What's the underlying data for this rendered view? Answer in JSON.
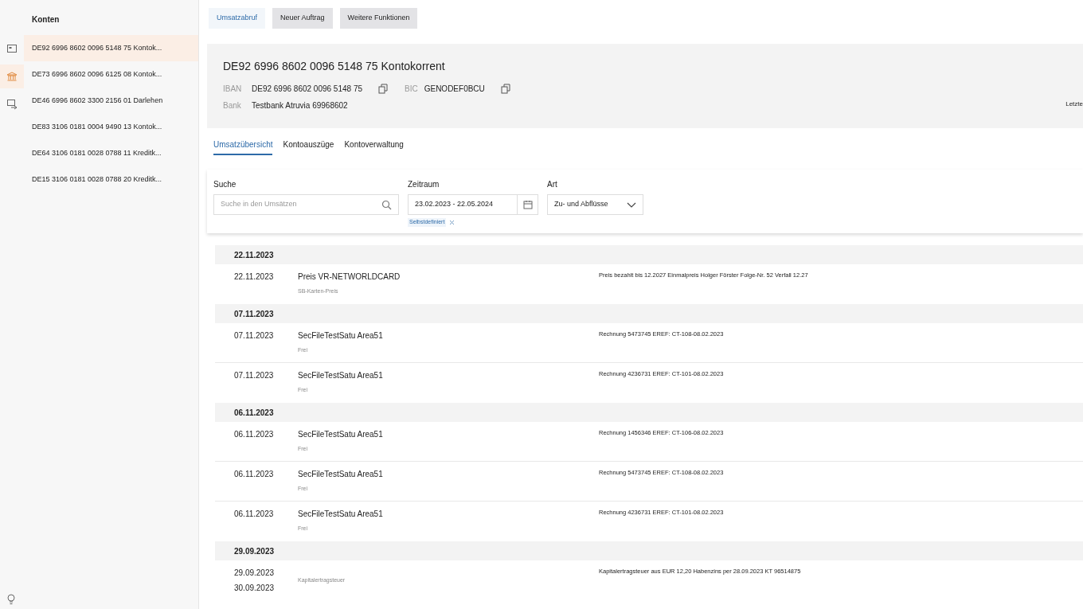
{
  "nav_rail": [
    {
      "kind": "card",
      "selected": false
    },
    {
      "kind": "bank",
      "selected": true
    },
    {
      "kind": "transfer",
      "selected": false
    }
  ],
  "sidebar": {
    "title": "Konten",
    "items": [
      {
        "label": "DE92 6996 8602 0096 5148 75 Kontok...",
        "selected": true
      },
      {
        "label": "DE73 6996 8602 0096 6125 08 Kontok...",
        "selected": false
      },
      {
        "label": "DE46 6996 8602 3300 2156 01 Darlehen",
        "selected": false
      },
      {
        "label": "DE83 3106 0181 0004 9490 13 Kontok...",
        "selected": false
      },
      {
        "label": "DE64 3106 0181 0028 0788 11 Kreditk...",
        "selected": false
      },
      {
        "label": "DE15 3106 0181 0028 0788 20 Kreditk...",
        "selected": false
      }
    ]
  },
  "toolbar": [
    {
      "label": "Umsatzabruf",
      "selected": true
    },
    {
      "label": "Neuer Auftrag",
      "selected": false
    },
    {
      "label": "Weitere Funktionen",
      "selected": false
    }
  ],
  "account": {
    "title": "DE92 6996 8602 0096 5148 75 Kontokorrent",
    "iban_label": "IBAN",
    "iban": "DE92 6996 8602 0096 5148 75",
    "bic_label": "BIC",
    "bic": "GENODEF0BCU",
    "bank_label": "Bank",
    "bank": "Testbank Atruvia 69968602",
    "side_label": "Letzte"
  },
  "tabs": [
    {
      "label": "Umsatzübersicht",
      "selected": true
    },
    {
      "label": "Kontoauszüge",
      "selected": false
    },
    {
      "label": "Kontoverwaltung",
      "selected": false
    }
  ],
  "filters": {
    "search_label": "Suche",
    "search_placeholder": "Suche in den Umsätzen",
    "period_label": "Zeitraum",
    "period": "23.02.2023 - 22.05.2024",
    "period_chip": "Selbstdefiniert",
    "type_label": "Art",
    "type": "Zu- und Abflüsse"
  },
  "groups": [
    {
      "date": "22.11.2023",
      "items": [
        {
          "date": "22.11.2023",
          "title": "Preis VR-NETWORLDCARD",
          "subtitle": "SB-Karten-Preis",
          "description": "Preis bezahlt bis 12.2027 Einmalpreis Holger Förster Folge-Nr. 52 Verfall 12.27"
        }
      ]
    },
    {
      "date": "07.11.2023",
      "items": [
        {
          "date": "07.11.2023",
          "title": "SecFileTestSatu Area51",
          "subtitle": "Frei",
          "description": "Rechnung 5473745 EREF: CT-108-08.02.2023"
        },
        {
          "date": "07.11.2023",
          "title": "SecFileTestSatu Area51",
          "subtitle": "Frei",
          "description": "Rechnung 4236731 EREF: CT-101-08.02.2023"
        }
      ]
    },
    {
      "date": "06.11.2023",
      "items": [
        {
          "date": "06.11.2023",
          "title": "SecFileTestSatu Area51",
          "subtitle": "Frei",
          "description": "Rechnung 1456346 EREF: CT-106-08.02.2023"
        },
        {
          "date": "06.11.2023",
          "title": "SecFileTestSatu Area51",
          "subtitle": "Frei",
          "description": "Rechnung 5473745 EREF: CT-108-08.02.2023"
        },
        {
          "date": "06.11.2023",
          "title": "SecFileTestSatu Area51",
          "subtitle": "Frei",
          "description": "Rechnung 4236731 EREF: CT-101-08.02.2023"
        }
      ]
    },
    {
      "date": "29.09.2023",
      "items": [
        {
          "date": "29.09.2023",
          "value_date": "30.09.2023",
          "subtitle": "Kapitalertragsteuer",
          "description": "Kapitalertragsteuer aus EUR 12,20 Habenzins per 28.09.2023 KT 96514875"
        }
      ]
    }
  ]
}
